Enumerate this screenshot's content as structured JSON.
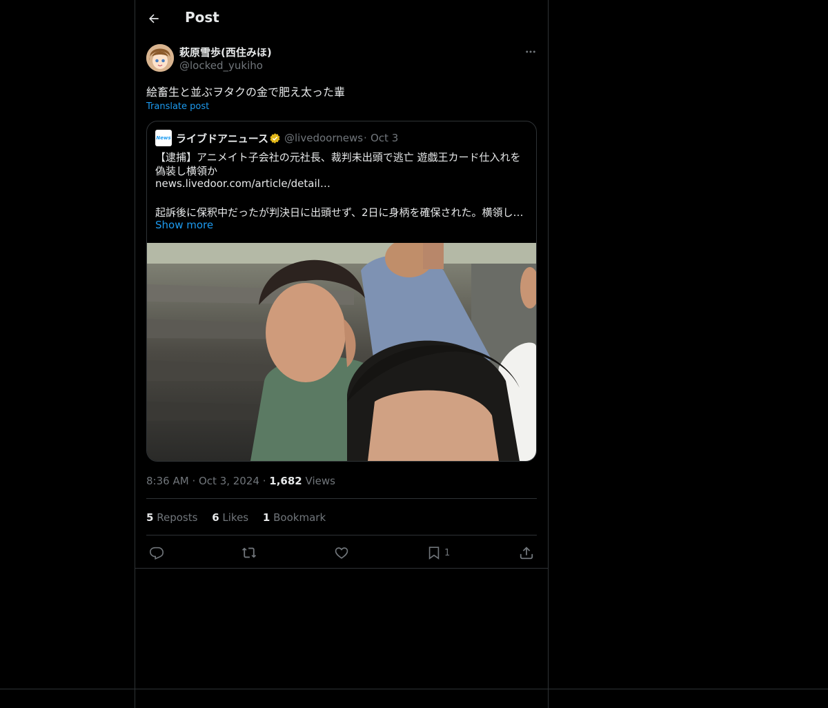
{
  "header": {
    "title": "Post"
  },
  "author": {
    "display_name": "萩原雪歩(西住みほ)",
    "handle": "@locked_yukiho"
  },
  "post": {
    "text": "絵畜生と並ぶヲタクの金で肥え太った輩",
    "translate_label": "Translate post",
    "time": "8:36 AM",
    "date": "Oct 3, 2024",
    "views_count": "1,682",
    "views_label": "Views"
  },
  "quote": {
    "logo_text": "News",
    "name": "ライブドアニュース",
    "handle": "@livedoornews",
    "date": "Oct 3",
    "lines": [
      "【逮捕】アニメイト子会社の元社長、裁判未出頭で逃亡 遊戯王カード仕入れを",
      "偽装し横領か",
      "news.livedoor.com/article/detail…",
      "起訴後に保釈中だったが判決日に出頭せず、2日に身柄を確保された。横領し…"
    ],
    "show_more": "Show more"
  },
  "stats": {
    "reposts_count": "5",
    "reposts_label": "Reposts",
    "likes_count": "6",
    "likes_label": "Likes",
    "bookmarks_count": "1",
    "bookmarks_label": "Bookmark"
  },
  "actions": {
    "bookmark_count": "1"
  },
  "colors": {
    "background": "#000000",
    "text": "#e7e9ea",
    "muted": "#71767b",
    "accent": "#1d9bf0",
    "border": "#2f3336",
    "verified": "#e2b719"
  },
  "icons": [
    "back-arrow-icon",
    "more-icon",
    "verified-badge-icon",
    "reply-icon",
    "repost-icon",
    "like-icon",
    "bookmark-icon",
    "share-icon"
  ]
}
